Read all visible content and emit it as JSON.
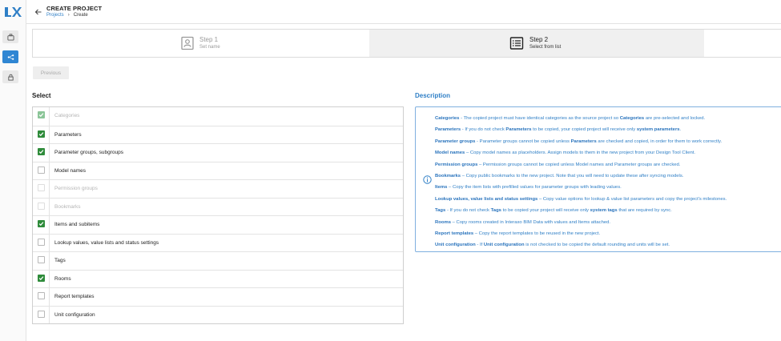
{
  "header": {
    "title": "CREATE PROJECT",
    "breadcrumb_link": "Projects",
    "breadcrumb_current": "Create"
  },
  "rail": {
    "active_item": "flow"
  },
  "stepper": {
    "steps": [
      {
        "name": "Step 1",
        "subtitle": "Set name",
        "state": "inactive"
      },
      {
        "name": "Step 2",
        "subtitle": "Select from list",
        "state": "active"
      }
    ]
  },
  "previous_label": "Previous",
  "select": {
    "title": "Select",
    "items": [
      {
        "label": "Categories",
        "checked": true,
        "disabled": true
      },
      {
        "label": "Parameters",
        "checked": true,
        "disabled": false
      },
      {
        "label": "Parameter groups, subgroups",
        "checked": true,
        "disabled": false
      },
      {
        "label": "Model names",
        "checked": false,
        "disabled": false
      },
      {
        "label": "Permission groups",
        "checked": false,
        "disabled": true
      },
      {
        "label": "Bookmarks",
        "checked": false,
        "disabled": true
      },
      {
        "label": "Items and subitems",
        "checked": true,
        "disabled": false
      },
      {
        "label": "Lookup values, value lists and status settings",
        "checked": false,
        "disabled": false
      },
      {
        "label": "Tags",
        "checked": false,
        "disabled": false
      },
      {
        "label": "Rooms",
        "checked": true,
        "disabled": false
      },
      {
        "label": "Report templates",
        "checked": false,
        "disabled": false
      },
      {
        "label": "Unit configuration",
        "checked": false,
        "disabled": false
      }
    ]
  },
  "description": {
    "title": "Description",
    "lines": [
      [
        {
          "b": "Categories"
        },
        {
          "t": " - The copied project must have identical categories as the source project so "
        },
        {
          "b": "Categories"
        },
        {
          "t": " are pre-selected and locked."
        }
      ],
      [
        {
          "b": "Parameters"
        },
        {
          "t": " - If you do not check "
        },
        {
          "b": "Parameters"
        },
        {
          "t": " to be copied, your copied project will receive only "
        },
        {
          "b": "system parameters"
        },
        {
          "t": "."
        }
      ],
      [
        {
          "b": "Parameter groups"
        },
        {
          "t": " - Parameter groups cannot be copied unless "
        },
        {
          "b": "Parameters"
        },
        {
          "t": " are checked and copied, in order for them to work correctly."
        }
      ],
      [
        {
          "b": "Model names"
        },
        {
          "t": " – Copy model names as placeholders. Assign models to them in the new project from your Design Tool Client."
        }
      ],
      [
        {
          "b": "Permission groups"
        },
        {
          "t": " – Permission groups cannot be copied unless Model names and Parameter groups are checked."
        }
      ],
      [
        {
          "b": "Bookmarks"
        },
        {
          "t": " – Copy public bookmarks to the new project. Note that you will need to update these after syncing models."
        }
      ],
      [
        {
          "b": "Items"
        },
        {
          "t": " – Copy the item lists with prefilled values for parameter groups with leading values."
        }
      ],
      [
        {
          "b": "Lookup values, value lists and status settings"
        },
        {
          "t": " – Copy value options for lookup & value list parameters and copy the project's milestones."
        }
      ],
      [
        {
          "b": "Tags"
        },
        {
          "t": " - If you do not check "
        },
        {
          "b": "Tags"
        },
        {
          "t": " to be copied your project will receive only "
        },
        {
          "b": "system tags"
        },
        {
          "t": " that are required by sync."
        }
      ],
      [
        {
          "b": "Rooms"
        },
        {
          "t": " – Copy rooms created in Interaxo BIM Data with values and Items attached."
        }
      ],
      [
        {
          "b": "Report templates"
        },
        {
          "t": " – Copy the report templates to be reused in the new project."
        }
      ],
      [
        {
          "b": "Unit configuration"
        },
        {
          "t": " - If "
        },
        {
          "b": "Unit configuration"
        },
        {
          "t": " is not checked to be copied the default rounding and units will be set."
        }
      ]
    ]
  },
  "colors": {
    "accent": "#2f7fc6",
    "check_green": "#2e8b3a",
    "rail_active": "#2f86d3"
  }
}
